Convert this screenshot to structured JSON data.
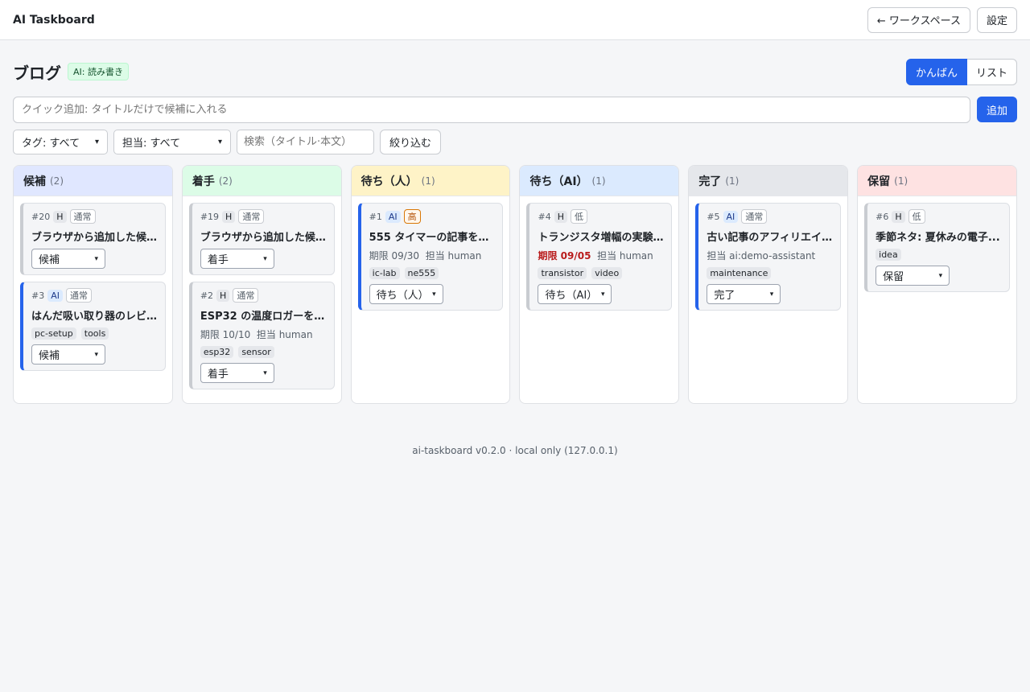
{
  "app": {
    "title": "AI Taskboard"
  },
  "header": {
    "back_label": "← ワークスペース",
    "settings_label": "設定"
  },
  "page": {
    "title": "ブログ",
    "ai_badge": "AI: 読み書き"
  },
  "view_toggle": {
    "kanban": "かんばん",
    "list": "リスト"
  },
  "quick_add": {
    "placeholder": "クイック追加: タイトルだけで候補に入れる",
    "button": "追加"
  },
  "filters": {
    "tag": "タグ: すべて",
    "assignee": "担当: すべて",
    "search_placeholder": "検索（タイトル·本文）",
    "apply": "絞り込む"
  },
  "columns": [
    {
      "title": "候補",
      "count": "(2)",
      "color": "#e0e7ff",
      "cards": [
        {
          "id": "#20",
          "owner": "H",
          "owner_type": "human",
          "priority": "通常",
          "priority_type": "normal",
          "title": "ブラウザから追加した候補...",
          "due": "",
          "due_overdue": false,
          "assignee": "",
          "tags": [],
          "status": "候補"
        },
        {
          "id": "#3",
          "owner": "AI",
          "owner_type": "ai",
          "priority": "通常",
          "priority_type": "normal",
          "title": "はんだ吸い取り器のレビュ...",
          "due": "",
          "due_overdue": false,
          "assignee": "",
          "tags": [
            "pc-setup",
            "tools"
          ],
          "status": "候補"
        }
      ]
    },
    {
      "title": "着手",
      "count": "(2)",
      "color": "#dcfce7",
      "cards": [
        {
          "id": "#19",
          "owner": "H",
          "owner_type": "human",
          "priority": "通常",
          "priority_type": "normal",
          "title": "ブラウザから追加した候補 ...",
          "due": "",
          "due_overdue": false,
          "assignee": "",
          "tags": [],
          "status": "着手"
        },
        {
          "id": "#2",
          "owner": "H",
          "owner_type": "human",
          "priority": "通常",
          "priority_type": "normal",
          "title": "ESP32 の温度ロガーを 1 ...",
          "due": "期限 10/10",
          "due_overdue": false,
          "assignee": "担当 human",
          "tags": [
            "esp32",
            "sensor"
          ],
          "status": "着手"
        }
      ]
    },
    {
      "title": "待ち（人）",
      "count": "(1)",
      "color": "#fef3c7",
      "cards": [
        {
          "id": "#1",
          "owner": "AI",
          "owner_type": "ai",
          "priority": "高",
          "priority_type": "high",
          "title": "555 タイマーの記事を書く...",
          "due": "期限 09/30",
          "due_overdue": false,
          "assignee": "担当 human",
          "tags": [
            "ic-lab",
            "ne555"
          ],
          "status": "待ち（人）"
        }
      ]
    },
    {
      "title": "待ち（AI）",
      "count": "(1)",
      "color": "#dbeafe",
      "cards": [
        {
          "id": "#4",
          "owner": "H",
          "owner_type": "human",
          "priority": "低",
          "priority_type": "low",
          "title": "トランジスタ増幅の実験を...",
          "due": "期限 09/05",
          "due_overdue": true,
          "assignee": "担当 human",
          "tags": [
            "transistor",
            "video"
          ],
          "status": "待ち（AI）"
        }
      ]
    },
    {
      "title": "完了",
      "count": "(1)",
      "color": "#e5e7eb",
      "cards": [
        {
          "id": "#5",
          "owner": "AI",
          "owner_type": "ai",
          "priority": "通常",
          "priority_type": "normal",
          "title": "古い記事のアフィリエイトリ...",
          "due": "",
          "due_overdue": false,
          "assignee": "担当 ai:demo-assistant",
          "tags": [
            "maintenance"
          ],
          "status": "完了"
        }
      ]
    },
    {
      "title": "保留",
      "count": "(1)",
      "color": "#fee2e2",
      "cards": [
        {
          "id": "#6",
          "owner": "H",
          "owner_type": "human",
          "priority": "低",
          "priority_type": "low",
          "title": "季節ネタ: 夏休みの電子...",
          "due": "",
          "due_overdue": false,
          "assignee": "",
          "tags": [
            "idea"
          ],
          "status": "保留"
        }
      ]
    }
  ],
  "footer": {
    "text": "ai-taskboard v0.2.0 · local only (127.0.0.1)"
  }
}
